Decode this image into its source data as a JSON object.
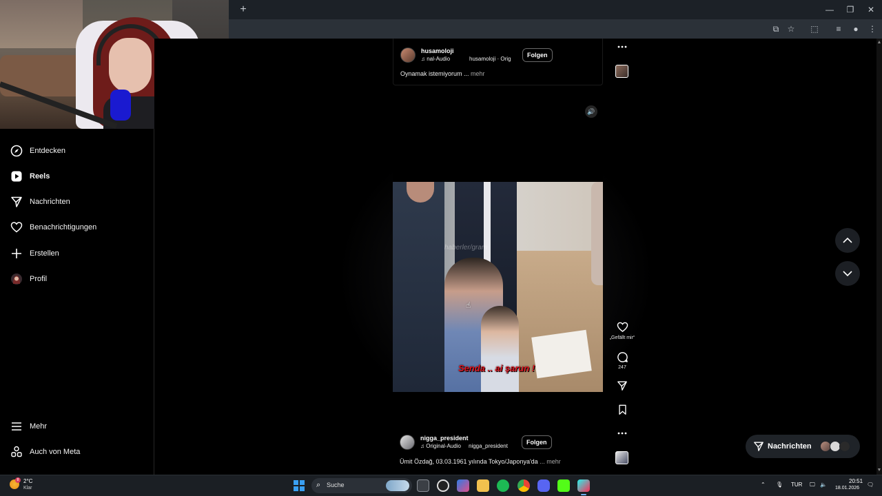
{
  "sidebar": {
    "items": [
      {
        "label": "Entdecken",
        "icon": "compass-icon"
      },
      {
        "label": "Reels",
        "icon": "reels-icon"
      },
      {
        "label": "Nachrichten",
        "icon": "send-icon"
      },
      {
        "label": "Benachrichtigungen",
        "icon": "heart-icon"
      },
      {
        "label": "Erstellen",
        "icon": "plus-icon"
      },
      {
        "label": "Profil",
        "icon": "profile-avatar"
      }
    ],
    "bottom": [
      {
        "label": "Mehr",
        "icon": "menu-icon"
      },
      {
        "label": "Auch von Meta",
        "icon": "meta-icon"
      }
    ]
  },
  "prev_post": {
    "username": "husamoloji",
    "audio": "nal-Audio",
    "audio_secondary": "husamoloji · Orig",
    "follow_label": "Folgen",
    "caption": "Oynamak istemiyorum ...",
    "more_label": "mehr"
  },
  "reel": {
    "username": "nigga_president",
    "audio": "Original-Audio",
    "audio_secondary": "nigga_president",
    "follow_label": "Folgen",
    "caption": "Ümit Özdağ, 03.03.1961 yılında Tokyo/Japonya'da",
    "more_label": "... mehr",
    "subtitle": "Senda .. ai şarun !",
    "watermark": "haberler/gram"
  },
  "actions": {
    "like_label": "„Gefällt mir“",
    "comment_count": "247"
  },
  "messages_pill": {
    "label": "Nachrichten"
  },
  "taskbar": {
    "weather_temp": "2°C",
    "weather_desc": "Klar",
    "weather_badge": "8",
    "search_label": "Suche",
    "lang": "TUR",
    "time": "20:51",
    "date": "18.01.2026"
  },
  "colors": {
    "background": "#000000",
    "accent_taskbar": "#3aa0f3",
    "subtitle_red": "#e1141e"
  }
}
